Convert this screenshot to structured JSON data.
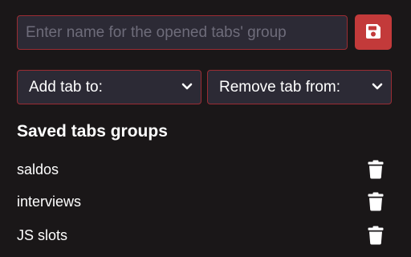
{
  "name_input": {
    "placeholder": "Enter name for the opened tabs' group",
    "value": ""
  },
  "save_button": {
    "icon": "floppy-disk-icon"
  },
  "selects": {
    "add": {
      "label": "Add tab to:",
      "icon": "chevron-down-icon"
    },
    "remove": {
      "label": "Remove tab from:",
      "icon": "chevron-down-icon"
    }
  },
  "saved_groups": {
    "heading": "Saved tabs groups",
    "items": [
      {
        "label": "saldos",
        "icon": "trash-icon"
      },
      {
        "label": "interviews",
        "icon": "trash-icon"
      },
      {
        "label": "JS slots",
        "icon": "trash-icon"
      }
    ]
  },
  "colors": {
    "background": "#1a1718",
    "field_background": "#2c2a35",
    "field_border": "#9b2c33",
    "accent": "#c33a3a",
    "text": "#ffffff",
    "placeholder": "#6e6c7a"
  }
}
